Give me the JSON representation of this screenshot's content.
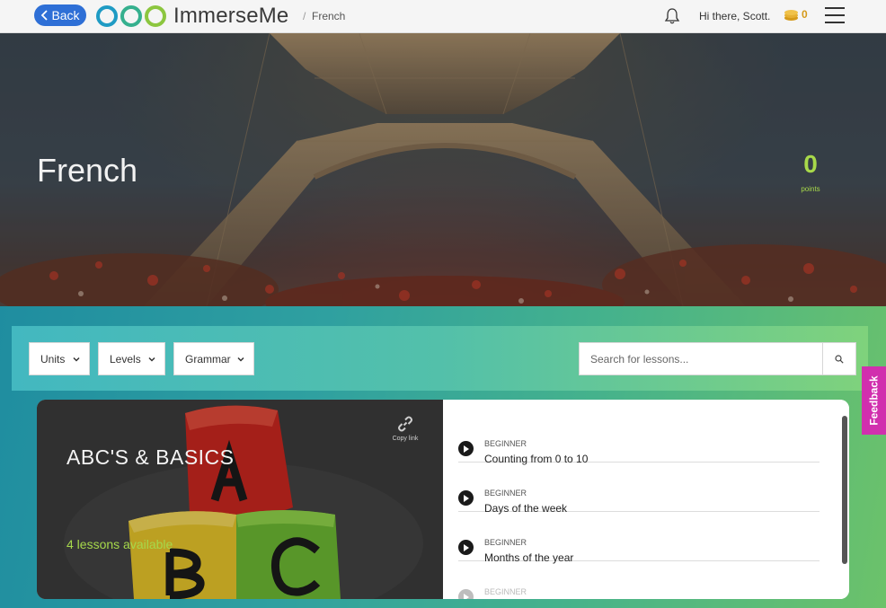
{
  "nav": {
    "back_label": "Back",
    "brand": "ImmerseMe",
    "breadcrumb_sep": "/",
    "breadcrumb_current": "French",
    "greeting": "Hi there, Scott.",
    "coins": "0"
  },
  "hero": {
    "title": "French",
    "points_value": "0",
    "points_label": "points"
  },
  "filters": {
    "units_label": "Units",
    "levels_label": "Levels",
    "grammar_label": "Grammar",
    "search_placeholder": "Search for lessons..."
  },
  "feedback_label": "Feedback",
  "unit": {
    "title": "ABC'S & BASICS",
    "lessons_available": "4 lessons available",
    "copy_link_label": "Copy link",
    "lessons": [
      {
        "level": "BEGINNER",
        "title": "Counting from 0 to 10"
      },
      {
        "level": "BEGINNER",
        "title": "Days of the week"
      },
      {
        "level": "BEGINNER",
        "title": "Months of the year"
      },
      {
        "level": "BEGINNER",
        "title": ""
      }
    ]
  },
  "colors": {
    "accent_blue": "#2e6fd6",
    "points_green": "#a8d94a",
    "feedback_pink": "#d12fae",
    "coin_gold": "#d59a1a"
  },
  "icons": [
    "chevron-left-icon",
    "logo-infinity-icon",
    "bell-icon",
    "coin-icon",
    "hamburger-menu-icon",
    "chevron-down-icon",
    "search-icon",
    "link-icon",
    "play-icon"
  ]
}
